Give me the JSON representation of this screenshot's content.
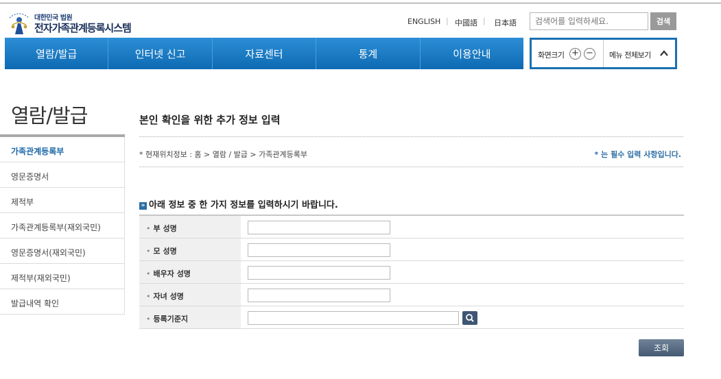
{
  "header": {
    "logo_small": "대한민국 법원",
    "logo_big": "전자가족관계등록시스템",
    "languages": [
      "ENGLISH",
      "中國語",
      "日本語"
    ],
    "search_placeholder": "검색어를 입력하세요.",
    "search_button": "검색"
  },
  "nav": {
    "items": [
      "열람/발급",
      "인터넷 신고",
      "자료센터",
      "통계",
      "이용안내"
    ],
    "screen_size_label": "화면크기",
    "zoom_in": "+",
    "zoom_out": "−",
    "menu_all_label": "메뉴 전체보기"
  },
  "sidebar": {
    "title": "열람/발급",
    "items": [
      {
        "label": "가족관계등록부",
        "active": true
      },
      {
        "label": "영문증명서",
        "active": false
      },
      {
        "label": "제적부",
        "active": false
      },
      {
        "label": "가족관계등록부(재외국민)",
        "active": false
      },
      {
        "label": "영문증명서(재외국민)",
        "active": false
      },
      {
        "label": "제적부(재외국민)",
        "active": false
      },
      {
        "label": "발급내역 확인",
        "active": false
      }
    ]
  },
  "content": {
    "title": "본인 확인을 위한 추가 정보 입력",
    "location": "* 현재위치정보 : 홈 > 열람 / 발급 > 가족관계등록부",
    "required_note": "* 는 필수 입력 사항입니다.",
    "section_title": "아래 정보 중 한 가지 정보를 입력하시기 바랍니다.",
    "fields": [
      {
        "label": "부 성명",
        "value": ""
      },
      {
        "label": "모 성명",
        "value": ""
      },
      {
        "label": "배우자 성명",
        "value": ""
      },
      {
        "label": "자녀 성명",
        "value": ""
      },
      {
        "label": "등록기준지",
        "value": ""
      }
    ],
    "submit_label": "조회"
  },
  "colors": {
    "nav_blue": "#1a78c2",
    "active_link": "#1d67a8",
    "submit_button": "#556a82"
  }
}
